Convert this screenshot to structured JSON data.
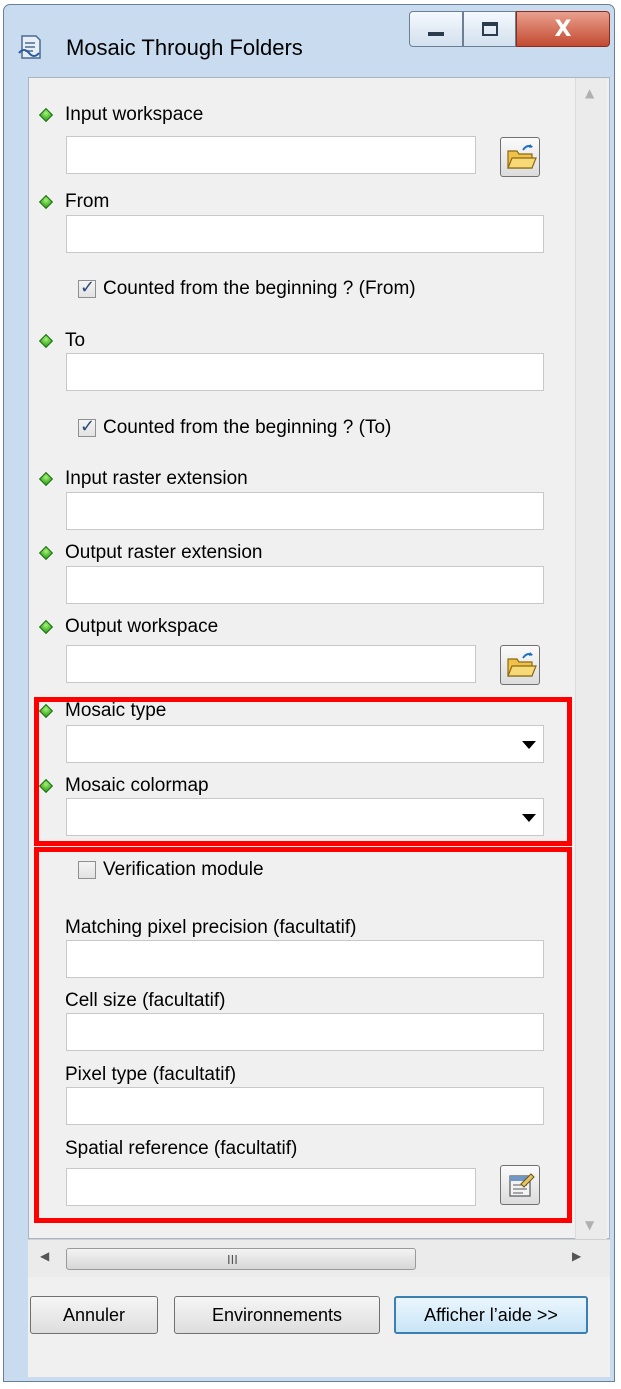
{
  "window": {
    "title": "Mosaic Through Folders",
    "minimize_icon": "minimize-icon",
    "maximize_icon": "maximize-icon",
    "close_icon": "close-icon",
    "close_glyph": "X"
  },
  "params": {
    "input_workspace": {
      "label": "Input workspace",
      "value": ""
    },
    "from": {
      "label": "From",
      "value": ""
    },
    "from_checkbox": {
      "label": "Counted from the beginning ? (From)",
      "checked": true
    },
    "to": {
      "label": "To",
      "value": ""
    },
    "to_checkbox": {
      "label": "Counted from the beginning ? (To)",
      "checked": true
    },
    "input_raster_ext": {
      "label": "Input raster extension",
      "value": ""
    },
    "output_raster_ext": {
      "label": "Output raster extension",
      "value": ""
    },
    "output_workspace": {
      "label": "Output workspace",
      "value": ""
    },
    "mosaic_type": {
      "label": "Mosaic type",
      "value": ""
    },
    "mosaic_colormap": {
      "label": "Mosaic colormap",
      "value": ""
    },
    "verification": {
      "label": "Verification  module",
      "checked": false
    },
    "matching_precision": {
      "label": "Matching pixel precision (facultatif)",
      "value": ""
    },
    "cell_size": {
      "label": "Cell size (facultatif)",
      "value": ""
    },
    "pixel_type": {
      "label": "Pixel type (facultatif)",
      "value": ""
    },
    "spatial_reference": {
      "label": "Spatial reference (facultatif)",
      "value": ""
    }
  },
  "scroll": {
    "grip": "III"
  },
  "buttons": {
    "cancel": "Annuler",
    "environments": "Environnements",
    "help": "Afficher l’aide >>"
  },
  "colors": {
    "highlight": "#ff0000",
    "required_dot": "#1f9a0a"
  }
}
